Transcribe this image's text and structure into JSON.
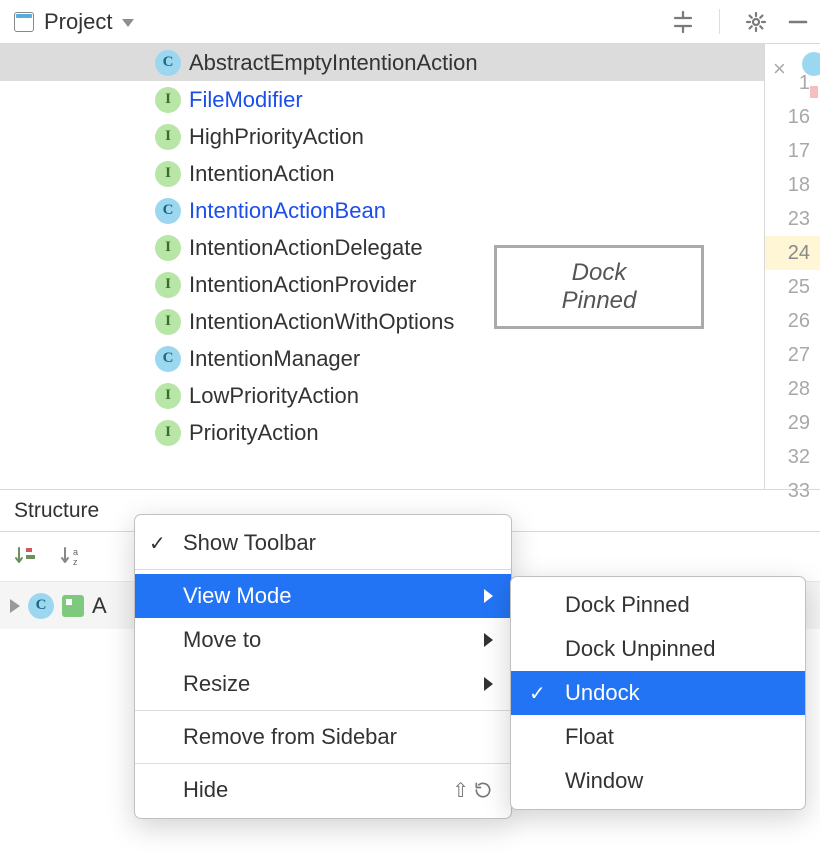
{
  "header": {
    "project_label": "Project"
  },
  "tooltip": {
    "line1": "Dock",
    "line2": "Pinned"
  },
  "tree": [
    {
      "badge": "C",
      "type": "c",
      "label": "AbstractEmptyIntentionAction",
      "link": false,
      "selected": true
    },
    {
      "badge": "I",
      "type": "i",
      "label": "FileModifier",
      "link": true,
      "selected": false
    },
    {
      "badge": "I",
      "type": "i",
      "label": "HighPriorityAction",
      "link": false,
      "selected": false
    },
    {
      "badge": "I",
      "type": "i",
      "label": "IntentionAction",
      "link": false,
      "selected": false
    },
    {
      "badge": "C",
      "type": "c",
      "label": "IntentionActionBean",
      "link": true,
      "selected": false
    },
    {
      "badge": "I",
      "type": "i",
      "label": "IntentionActionDelegate",
      "link": false,
      "selected": false
    },
    {
      "badge": "I",
      "type": "i",
      "label": "IntentionActionProvider",
      "link": false,
      "selected": false
    },
    {
      "badge": "I",
      "type": "i",
      "label": "IntentionActionWithOptions",
      "link": false,
      "selected": false
    },
    {
      "badge": "C",
      "type": "c",
      "label": "IntentionManager",
      "link": false,
      "selected": false
    },
    {
      "badge": "I",
      "type": "i",
      "label": "LowPriorityAction",
      "link": false,
      "selected": false
    },
    {
      "badge": "I",
      "type": "i",
      "label": "PriorityAction",
      "link": false,
      "selected": false
    }
  ],
  "gutter_lines": [
    1,
    16,
    17,
    18,
    23,
    24,
    25,
    26,
    27,
    28,
    29,
    32,
    33
  ],
  "gutter_active": 24,
  "structure": {
    "title": "Structure",
    "selected_prefix": "A"
  },
  "context_menu": [
    {
      "label": "Show Toolbar",
      "checked": true,
      "submenu": false,
      "highlight": false,
      "shortcut": null
    },
    {
      "sep": true
    },
    {
      "label": "View Mode",
      "checked": false,
      "submenu": true,
      "highlight": true,
      "shortcut": null
    },
    {
      "label": "Move to",
      "checked": false,
      "submenu": true,
      "highlight": false,
      "shortcut": null
    },
    {
      "label": "Resize",
      "checked": false,
      "submenu": true,
      "highlight": false,
      "shortcut": null
    },
    {
      "sep": true
    },
    {
      "label": "Remove from Sidebar",
      "checked": false,
      "submenu": false,
      "highlight": false,
      "shortcut": null
    },
    {
      "sep": true
    },
    {
      "label": "Hide",
      "checked": false,
      "submenu": false,
      "highlight": false,
      "shortcut": "restore"
    }
  ],
  "view_mode_submenu": [
    {
      "label": "Dock Pinned",
      "checked": false,
      "highlight": false
    },
    {
      "label": "Dock Unpinned",
      "checked": false,
      "highlight": false
    },
    {
      "label": "Undock",
      "checked": true,
      "highlight": true
    },
    {
      "label": "Float",
      "checked": false,
      "highlight": false
    },
    {
      "label": "Window",
      "checked": false,
      "highlight": false
    }
  ]
}
